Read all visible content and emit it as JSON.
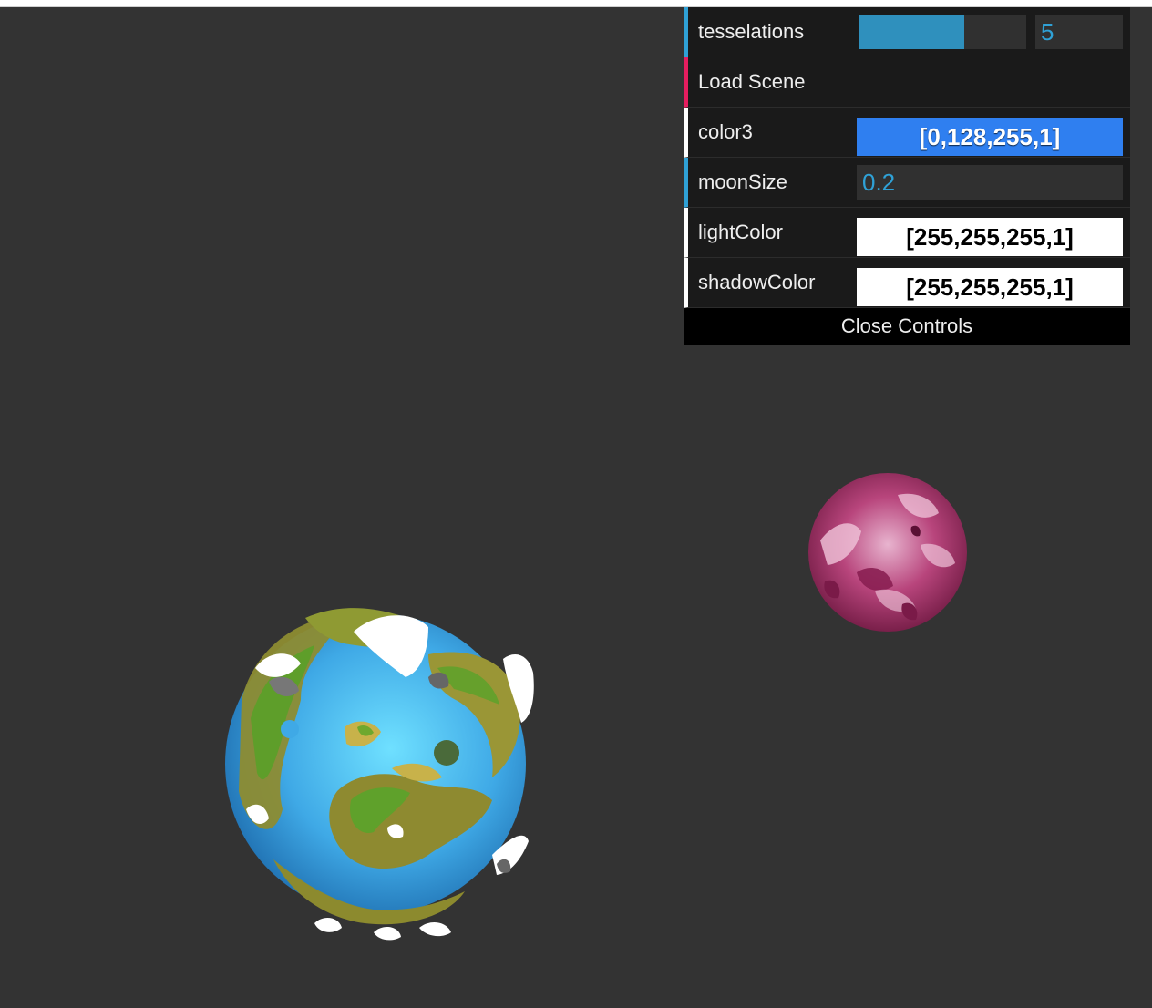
{
  "controls": {
    "tesselations": {
      "label": "tesselations",
      "value": "5",
      "slider_fraction": 0.63
    },
    "load_scene": {
      "label": "Load Scene"
    },
    "color3": {
      "label": "color3",
      "value": "[0,128,255,1]",
      "swatch_color": "#2f7ff0",
      "text_color": "#ffffff"
    },
    "moon_size": {
      "label": "moonSize",
      "value": "0.2"
    },
    "light_color": {
      "label": "lightColor",
      "value": "[255,255,255,1]",
      "swatch_color": "#ffffff",
      "text_color": "#000000"
    },
    "shadow_color": {
      "label": "shadowColor",
      "value": "[255,255,255,1]",
      "swatch_color": "#ffffff",
      "text_color": "#000000"
    },
    "close_label": "Close Controls"
  },
  "theme": {
    "background": "#333333",
    "number_accent": "#2fa1d6",
    "function_accent": "#e61d5f",
    "panel_bg": "#1a1a1a"
  }
}
